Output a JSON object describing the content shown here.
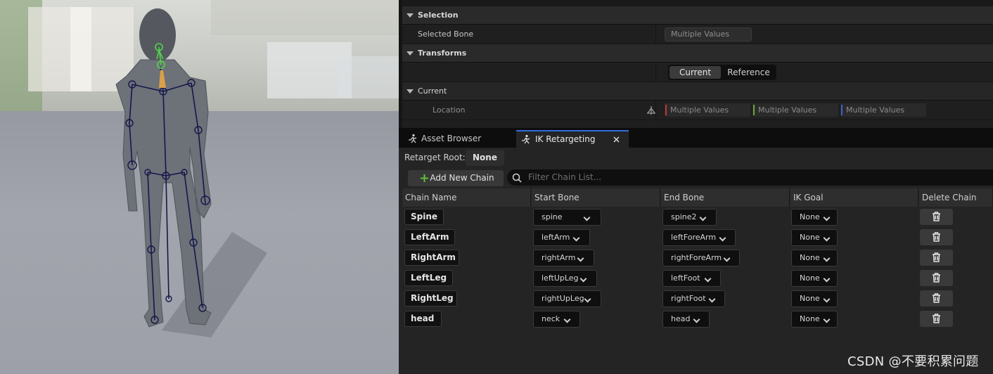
{
  "details": {
    "selection_header": "Selection",
    "selected_bone_label": "Selected Bone",
    "selected_bone_value": "Multiple Values",
    "transforms_header": "Transforms",
    "toggle_current": "Current",
    "toggle_reference": "Reference",
    "current_header": "Current",
    "location_label": "Location",
    "location_x": "Multiple Values",
    "location_y": "Multiple Values",
    "location_z": "Multiple Values"
  },
  "tabs": [
    {
      "label": "Asset Browser"
    },
    {
      "label": "IK Retargeting"
    }
  ],
  "toolbar": {
    "retarget_root_label": "Retarget Root:",
    "retarget_root_value": "None",
    "add_chain_label": "Add New Chain",
    "filter_placeholder": "Filter Chain List..."
  },
  "table": {
    "columns": [
      "Chain Name",
      "Start Bone",
      "End Bone",
      "IK Goal",
      "Delete Chain"
    ],
    "rows": [
      {
        "name": "Spine",
        "start": "spine",
        "end": "spine2",
        "goal": "None"
      },
      {
        "name": "LeftArm",
        "start": "leftArm",
        "end": "leftForeArm",
        "goal": "None"
      },
      {
        "name": "RightArm",
        "start": "rightArm",
        "end": "rightForeArm",
        "goal": "None"
      },
      {
        "name": "LeftLeg",
        "start": "leftUpLeg",
        "end": "leftFoot",
        "goal": "None"
      },
      {
        "name": "RightLeg",
        "start": "rightUpLeg",
        "end": "rightFoot",
        "goal": "None"
      },
      {
        "name": "head",
        "start": "neck",
        "end": "head",
        "goal": "None"
      }
    ]
  },
  "watermark": "CSDN @不要积累问题",
  "icons": {
    "close": "close-icon",
    "search": "search-icon",
    "add": "plus-icon",
    "delete": "trash-icon",
    "tab": "running-figure-icon"
  },
  "colors": {
    "accent": "#2f6ed9",
    "add_icon": "#5fbf3a",
    "axis_x": "#c33636",
    "axis_y": "#6ea83a",
    "axis_z": "#3a63c9"
  }
}
